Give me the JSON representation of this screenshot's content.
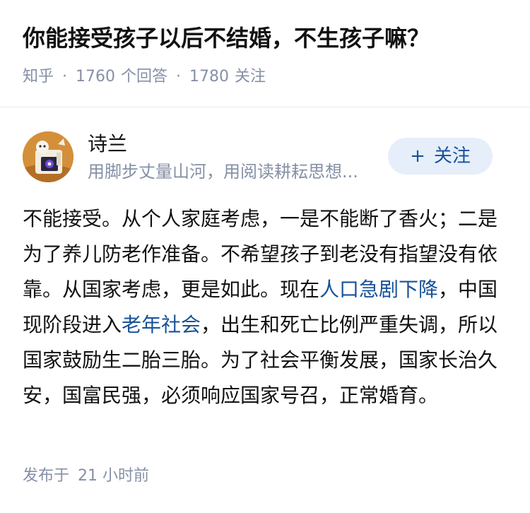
{
  "question": {
    "title": "你能接受孩子以后不结婚，不生孩子嘛？",
    "source": "知乎",
    "answers_count": "1760",
    "answers_label": "个回答",
    "followers_count": "1780",
    "followers_label": "关注",
    "separator": "·"
  },
  "author": {
    "name": "诗兰",
    "bio": "用脚步丈量山河，用阅读耕耘思想...",
    "avatar_icon": "illustrated-avatar-icon",
    "follow_button": {
      "plus": "+",
      "label": "关注"
    }
  },
  "answer": {
    "segments": [
      "不能接受。从个人家庭考虑，一是不能断了香火；二是为了养儿防老作准备。不希望孩子到老没有指望没有依靠。从国家考虑，更是如此。现在",
      "人口急剧下降",
      "，中国现阶段进入",
      "老年社会",
      "，出生和死亡比例严重失调，所以国家鼓励生二胎三胎。为了社会平衡发展，国家长治久安，国富民强，必须响应国家号召，正常婚育。"
    ],
    "published_label": "发布于",
    "published_time": "21 小时前"
  },
  "colors": {
    "link": "#175199",
    "meta": "#8590a6",
    "follow_bg": "#e6eefa"
  }
}
